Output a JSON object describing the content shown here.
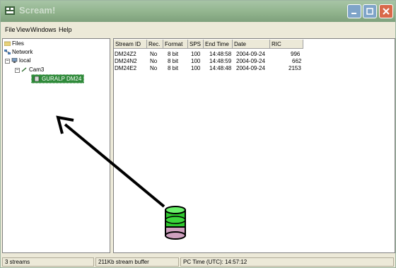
{
  "window": {
    "title": "Scream!"
  },
  "menu": [
    "File",
    "View",
    "Windows",
    "Help"
  ],
  "tree": {
    "files": "Files",
    "network": "Network",
    "local": "local",
    "cam": "Cam3",
    "selected": "GURALP DM24"
  },
  "list": {
    "columns": [
      "Stream ID",
      "Rec.",
      "Format",
      "SPS",
      "End Time",
      "Date",
      "RIC"
    ],
    "rows": [
      [
        "DM24Z2",
        "No",
        "8 bit",
        "100",
        "14:48:58",
        "2004-09-24",
        "996"
      ],
      [
        "DM24N2",
        "No",
        "8 bit",
        "100",
        "14:48:59",
        "2004-09-24",
        "662"
      ],
      [
        "DM24E2",
        "No",
        "8 bit",
        "100",
        "14:48:48",
        "2004-09-24",
        "2153"
      ]
    ]
  },
  "status": {
    "streams": "3 streams",
    "buffer": "211Kb stream buffer",
    "pctime": "PC Time (UTC): 14:57:12"
  },
  "colors": {
    "titlebar": "#8fb28b",
    "selection": "#2f8a3a",
    "close": "#d9694a"
  },
  "icons": [
    "app-icon",
    "minimize-icon",
    "maximize-icon",
    "close-icon",
    "folder-icon",
    "network-icon",
    "computer-icon",
    "camera-icon",
    "digitizer-icon",
    "database-icon",
    "arrow-pointer"
  ]
}
